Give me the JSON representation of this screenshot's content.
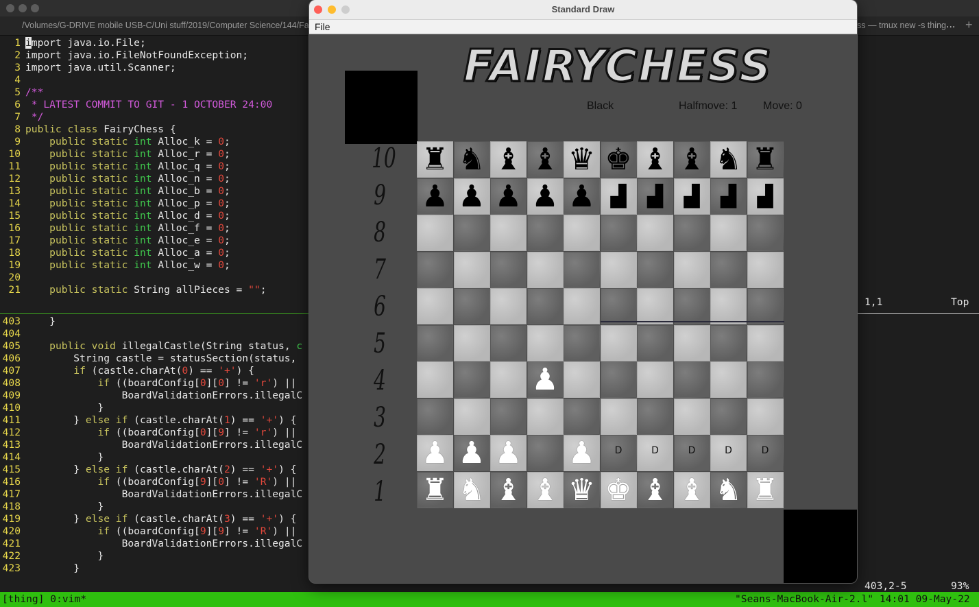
{
  "terminal": {
    "tab_path": "/Volumes/G-DRIVE mobile USB-C/Uni stuff/2019/Computer Science/144/Fa",
    "tab_right": "ss — tmux new -s thing",
    "tab_more": "...",
    "tab_plus": "+",
    "top_pane": [
      {
        "n": "1",
        "parts": [
          [
            "cursor",
            "i"
          ],
          [
            "",
            "mport java.io.File;"
          ]
        ]
      },
      {
        "n": "2",
        "parts": [
          [
            "",
            "import java.io.FileNotFoundException;"
          ]
        ]
      },
      {
        "n": "3",
        "parts": [
          [
            "",
            "import java.util.Scanner;"
          ]
        ]
      },
      {
        "n": "4",
        "parts": []
      },
      {
        "n": "5",
        "parts": [
          [
            "c",
            "/**"
          ]
        ]
      },
      {
        "n": "6",
        "parts": [
          [
            "c",
            " * LATEST COMMIT TO GIT - 1 OCTOBER 24:00"
          ]
        ]
      },
      {
        "n": "7",
        "parts": [
          [
            "c",
            " */"
          ]
        ]
      },
      {
        "n": "8",
        "parts": [
          [
            "k",
            "public class"
          ],
          [
            "",
            " FairyChess {"
          ]
        ]
      },
      {
        "n": "9",
        "parts": [
          [
            "",
            "    "
          ],
          [
            "k",
            "public static"
          ],
          [
            "",
            " "
          ],
          [
            "t",
            "int"
          ],
          [
            "",
            " Alloc_k = "
          ],
          [
            "n",
            "0"
          ],
          [
            "",
            ";"
          ]
        ]
      },
      {
        "n": "10",
        "parts": [
          [
            "",
            "    "
          ],
          [
            "k",
            "public static"
          ],
          [
            "",
            " "
          ],
          [
            "t",
            "int"
          ],
          [
            "",
            " Alloc_r = "
          ],
          [
            "n",
            "0"
          ],
          [
            "",
            ";"
          ]
        ]
      },
      {
        "n": "11",
        "parts": [
          [
            "",
            "    "
          ],
          [
            "k",
            "public static"
          ],
          [
            "",
            " "
          ],
          [
            "t",
            "int"
          ],
          [
            "",
            " Alloc_q = "
          ],
          [
            "n",
            "0"
          ],
          [
            "",
            ";"
          ]
        ]
      },
      {
        "n": "12",
        "parts": [
          [
            "",
            "    "
          ],
          [
            "k",
            "public static"
          ],
          [
            "",
            " "
          ],
          [
            "t",
            "int"
          ],
          [
            "",
            " Alloc_n = "
          ],
          [
            "n",
            "0"
          ],
          [
            "",
            ";"
          ]
        ]
      },
      {
        "n": "13",
        "parts": [
          [
            "",
            "    "
          ],
          [
            "k",
            "public static"
          ],
          [
            "",
            " "
          ],
          [
            "t",
            "int"
          ],
          [
            "",
            " Alloc_b = "
          ],
          [
            "n",
            "0"
          ],
          [
            "",
            ";"
          ]
        ]
      },
      {
        "n": "14",
        "parts": [
          [
            "",
            "    "
          ],
          [
            "k",
            "public static"
          ],
          [
            "",
            " "
          ],
          [
            "t",
            "int"
          ],
          [
            "",
            " Alloc_p = "
          ],
          [
            "n",
            "0"
          ],
          [
            "",
            ";"
          ]
        ]
      },
      {
        "n": "15",
        "parts": [
          [
            "",
            "    "
          ],
          [
            "k",
            "public static"
          ],
          [
            "",
            " "
          ],
          [
            "t",
            "int"
          ],
          [
            "",
            " Alloc_d = "
          ],
          [
            "n",
            "0"
          ],
          [
            "",
            ";"
          ]
        ]
      },
      {
        "n": "16",
        "parts": [
          [
            "",
            "    "
          ],
          [
            "k",
            "public static"
          ],
          [
            "",
            " "
          ],
          [
            "t",
            "int"
          ],
          [
            "",
            " Alloc_f = "
          ],
          [
            "n",
            "0"
          ],
          [
            "",
            ";"
          ]
        ]
      },
      {
        "n": "17",
        "parts": [
          [
            "",
            "    "
          ],
          [
            "k",
            "public static"
          ],
          [
            "",
            " "
          ],
          [
            "t",
            "int"
          ],
          [
            "",
            " Alloc_e = "
          ],
          [
            "n",
            "0"
          ],
          [
            "",
            ";"
          ]
        ]
      },
      {
        "n": "18",
        "parts": [
          [
            "",
            "    "
          ],
          [
            "k",
            "public static"
          ],
          [
            "",
            " "
          ],
          [
            "t",
            "int"
          ],
          [
            "",
            " Alloc_a = "
          ],
          [
            "n",
            "0"
          ],
          [
            "",
            ";"
          ]
        ]
      },
      {
        "n": "19",
        "parts": [
          [
            "",
            "    "
          ],
          [
            "k",
            "public static"
          ],
          [
            "",
            " "
          ],
          [
            "t",
            "int"
          ],
          [
            "",
            " Alloc_w = "
          ],
          [
            "n",
            "0"
          ],
          [
            "",
            ";"
          ]
        ]
      },
      {
        "n": "20",
        "parts": []
      },
      {
        "n": "21",
        "parts": [
          [
            "",
            "    "
          ],
          [
            "k",
            "public static"
          ],
          [
            "",
            " String allPieces = "
          ],
          [
            "s",
            "\"\""
          ],
          [
            "",
            ";"
          ]
        ]
      }
    ],
    "top_ruler": {
      "pos": "1,1",
      "where": "Top"
    },
    "bottom_pane": [
      {
        "n": "403",
        "parts": [
          [
            "",
            "    }"
          ]
        ]
      },
      {
        "n": "404",
        "parts": []
      },
      {
        "n": "405",
        "parts": [
          [
            "",
            "    "
          ],
          [
            "k",
            "public void"
          ],
          [
            "",
            " illegalCastle(String status, "
          ],
          [
            "t",
            "c"
          ]
        ]
      },
      {
        "n": "406",
        "parts": [
          [
            "",
            "        String castle = statusSection(status,"
          ]
        ]
      },
      {
        "n": "407",
        "parts": [
          [
            "",
            "        "
          ],
          [
            "k",
            "if"
          ],
          [
            "",
            " (castle.charAt("
          ],
          [
            "n",
            "0"
          ],
          [
            "",
            ") == "
          ],
          [
            "s",
            "'+'"
          ],
          [
            "",
            ") {"
          ]
        ]
      },
      {
        "n": "408",
        "parts": [
          [
            "",
            "            "
          ],
          [
            "k",
            "if"
          ],
          [
            "",
            " ((boardConfig["
          ],
          [
            "n",
            "0"
          ],
          [
            "",
            "]["
          ],
          [
            "n",
            "0"
          ],
          [
            "",
            "] != "
          ],
          [
            "s",
            "'r'"
          ],
          [
            "",
            ") ||"
          ]
        ]
      },
      {
        "n": "409",
        "parts": [
          [
            "",
            "                BoardValidationErrors.illegalC"
          ]
        ]
      },
      {
        "n": "410",
        "parts": [
          [
            "",
            "            }"
          ]
        ]
      },
      {
        "n": "411",
        "parts": [
          [
            "",
            "        } "
          ],
          [
            "k",
            "else if"
          ],
          [
            "",
            " (castle.charAt("
          ],
          [
            "n",
            "1"
          ],
          [
            "",
            ") == "
          ],
          [
            "s",
            "'+'"
          ],
          [
            "",
            ") {"
          ]
        ]
      },
      {
        "n": "412",
        "parts": [
          [
            "",
            "            "
          ],
          [
            "k",
            "if"
          ],
          [
            "",
            " ((boardConfig["
          ],
          [
            "n",
            "0"
          ],
          [
            "",
            "]["
          ],
          [
            "n",
            "9"
          ],
          [
            "",
            "] != "
          ],
          [
            "s",
            "'r'"
          ],
          [
            "",
            ") ||"
          ]
        ]
      },
      {
        "n": "413",
        "parts": [
          [
            "",
            "                BoardValidationErrors.illegalC"
          ]
        ]
      },
      {
        "n": "414",
        "parts": [
          [
            "",
            "            }"
          ]
        ]
      },
      {
        "n": "415",
        "parts": [
          [
            "",
            "        } "
          ],
          [
            "k",
            "else if"
          ],
          [
            "",
            " (castle.charAt("
          ],
          [
            "n",
            "2"
          ],
          [
            "",
            ") == "
          ],
          [
            "s",
            "'+'"
          ],
          [
            "",
            ") {"
          ]
        ]
      },
      {
        "n": "416",
        "parts": [
          [
            "",
            "            "
          ],
          [
            "k",
            "if"
          ],
          [
            "",
            " ((boardConfig["
          ],
          [
            "n",
            "9"
          ],
          [
            "",
            "]["
          ],
          [
            "n",
            "0"
          ],
          [
            "",
            "] != "
          ],
          [
            "s",
            "'R'"
          ],
          [
            "",
            ") ||"
          ]
        ]
      },
      {
        "n": "417",
        "parts": [
          [
            "",
            "                BoardValidationErrors.illegalC"
          ]
        ]
      },
      {
        "n": "418",
        "parts": [
          [
            "",
            "            }"
          ]
        ]
      },
      {
        "n": "419",
        "parts": [
          [
            "",
            "        } "
          ],
          [
            "k",
            "else if"
          ],
          [
            "",
            " (castle.charAt("
          ],
          [
            "n",
            "3"
          ],
          [
            "",
            ") == "
          ],
          [
            "s",
            "'+'"
          ],
          [
            "",
            ") {"
          ]
        ]
      },
      {
        "n": "420",
        "parts": [
          [
            "",
            "            "
          ],
          [
            "k",
            "if"
          ],
          [
            "",
            " ((boardConfig["
          ],
          [
            "n",
            "9"
          ],
          [
            "",
            "]["
          ],
          [
            "n",
            "9"
          ],
          [
            "",
            "] != "
          ],
          [
            "s",
            "'R'"
          ],
          [
            "",
            ") ||"
          ]
        ]
      },
      {
        "n": "421",
        "parts": [
          [
            "",
            "                BoardValidationErrors.illegalC"
          ]
        ]
      },
      {
        "n": "422",
        "parts": [
          [
            "",
            "            }"
          ]
        ]
      },
      {
        "n": "423",
        "parts": [
          [
            "",
            "        }"
          ]
        ]
      }
    ],
    "bottom_ruler": {
      "pos": "403,2-5",
      "where": "93%"
    },
    "status_left": "[thing] 0:vim*",
    "status_right": "\"Seans-MacBook-Air-2.l\" 14:01 09-May-22"
  },
  "draw_window": {
    "title": "Standard Draw",
    "menu_file": "File",
    "logo": "FAIRYCHESS",
    "side_to_move": "Black",
    "halfmove": "Halfmove: 1",
    "move": "Move: 0",
    "ranks": [
      "10",
      "9",
      "8",
      "7",
      "6",
      "5",
      "4",
      "3",
      "2",
      "1"
    ],
    "board": [
      [
        "b:♜",
        "b:♞",
        "b:♝",
        "b:♝",
        "b:♛",
        "b:♚",
        "b:♝",
        "b:♝",
        "b:♞",
        "b:♜"
      ],
      [
        "b:♟",
        "b:♟",
        "b:♟",
        "b:♟",
        "b:♟",
        "m:▟",
        "m:▟",
        "m:▟",
        "m:▟",
        "m:▟"
      ],
      [
        "",
        "",
        "",
        "",
        "",
        "",
        "",
        "",
        "",
        ""
      ],
      [
        "",
        "",
        "",
        "",
        "",
        "",
        "",
        "",
        "",
        ""
      ],
      [
        "",
        "",
        "",
        "",
        "",
        "",
        "",
        "",
        "",
        ""
      ],
      [
        "",
        "",
        "",
        "",
        "",
        "",
        "",
        "",
        "",
        ""
      ],
      [
        "",
        "",
        "",
        "w:♟",
        "",
        "",
        "",
        "",
        "",
        ""
      ],
      [
        "",
        "",
        "",
        "",
        "",
        "",
        "",
        "",
        "",
        ""
      ],
      [
        "w:♟",
        "w:♟",
        "w:♟",
        "",
        "w:♟",
        "d:D",
        "d:D",
        "d:D",
        "d:D",
        "d:D"
      ],
      [
        "w:♜",
        "w:♞",
        "w:♝",
        "w:♝",
        "w:♛",
        "w:♚",
        "w:♝",
        "w:♝",
        "w:♞",
        "w:♜"
      ]
    ]
  }
}
